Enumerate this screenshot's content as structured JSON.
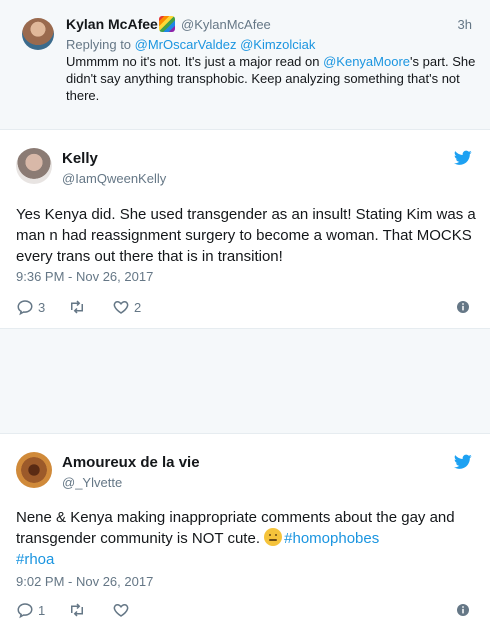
{
  "reply": {
    "name": "Kylan McAfee",
    "handle": "@KylanMcAfee",
    "time": "3h",
    "replying_prefix": "Replying to ",
    "replying_to_1": "@MrOscarValdez",
    "replying_to_2": "@Kimzolciak",
    "text_before": "Ummmm no it's not. It's just a major read on ",
    "text_mention": "@KenyaMoore",
    "text_after": "'s part. She didn't say anything transphobic. Keep analyzing something that's not there."
  },
  "tweets": [
    {
      "name": "Kelly",
      "handle": "@IamQweenKelly",
      "text": "Yes Kenya did. She used transgender as an insult! Stating Kim was a man n had reassignment surgery to become a woman. That MOCKS every trans out there that is in transition!",
      "date": "9:36 PM - Nov 26, 2017",
      "replies": "3",
      "retweets": "",
      "likes": "2"
    },
    {
      "name": "Amoureux de la vie",
      "handle": "@_Ylvette",
      "text": "Nene & Kenya making inappropriate comments about the gay and transgender community is NOT cute. ",
      "hashtag1": "#homophobes",
      "hashtag2": "#rhoa",
      "date": "9:02 PM - Nov 26, 2017",
      "replies": "1",
      "retweets": "",
      "likes": ""
    }
  ],
  "icons": {
    "brand": "twitter-bird-icon",
    "reply": "reply-icon",
    "retweet": "retweet-icon",
    "like": "heart-icon",
    "more": "info-icon",
    "emoji": "thinking-face-emoji"
  },
  "colors": {
    "link": "#1b95e0",
    "secondary_text": "#657786",
    "twitter_blue": "#1da1f2"
  }
}
